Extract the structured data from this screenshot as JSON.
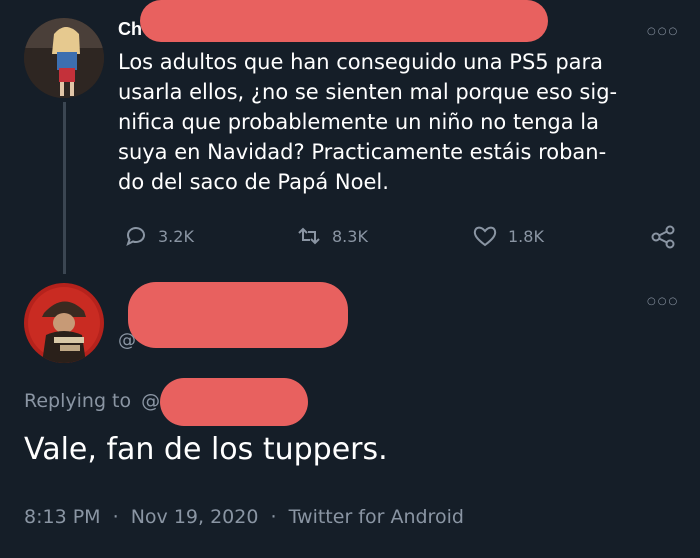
{
  "first_tweet": {
    "name_partial": "Ch",
    "text": "Los adultos que han conseguido una PS5 para\nusarla ellos, ¿no se sienten mal porque eso sig-\nnifica que probablemente un niño no tenga la\nsuya en Navidad? Practicamente estáis roban-\ndo del saco de Papá Noel.",
    "reply_count": "3.2K",
    "retweet_count": "8.3K",
    "like_count": "1.8K"
  },
  "reply_tweet": {
    "handle_prefix": "@",
    "replying_to_label": "Replying to",
    "replying_at": "@",
    "text": "Vale, fan de los tuppers.",
    "time": "8:13 PM",
    "separator": "·",
    "date": "Nov 19, 2020",
    "source": "Twitter for Android"
  },
  "colors": {
    "background": "#151e28",
    "secondary_text": "#8a95a3",
    "redaction": "#e8615f"
  }
}
